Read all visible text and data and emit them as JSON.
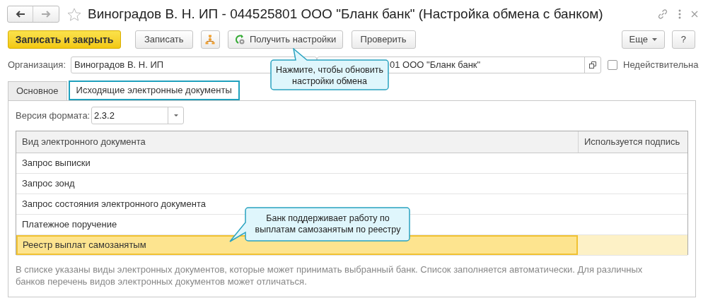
{
  "window": {
    "title": "Виноградов В. Н. ИП - 044525801 ООО \"Бланк банк\" (Настройка обмена с банком)"
  },
  "toolbar": [
    {
      "kind": "primary",
      "label": "Записать и закрыть"
    },
    {
      "kind": "default",
      "label": "Записать"
    },
    {
      "kind": "icon"
    },
    {
      "kind": "refresh",
      "label": "Получить настройки"
    },
    {
      "kind": "default",
      "label": "Проверить"
    },
    {
      "kind": "more",
      "label": "Еще"
    },
    {
      "kind": "default",
      "label": "?"
    }
  ],
  "organization": {
    "label": "Организация:",
    "value": "Виноградов В. Н. ИП"
  },
  "bank": {
    "value": "01 ООО \"Бланк банк\""
  },
  "invalid_checkbox": {
    "label": "Недействительна",
    "checked": false
  },
  "tabs": [
    {
      "label": "Основное",
      "selected": false
    },
    {
      "label": "Исходящие электронные документы",
      "selected": true
    }
  ],
  "format_version": {
    "label": "Версия формата:",
    "value": "2.3.2"
  },
  "table": {
    "columns": [
      "Вид электронного документа",
      "Используется подпись"
    ],
    "rows": [
      {
        "name": "Запрос выписки",
        "selected": false
      },
      {
        "name": "Запрос зонд",
        "selected": false
      },
      {
        "name": "Запрос состояния электронного документа",
        "selected": false
      },
      {
        "name": "Платежное поручение",
        "selected": false
      },
      {
        "name": "Реестр выплат самозанятым",
        "selected": true
      }
    ]
  },
  "note": "В списке указаны виды электронных документов, которые может принимать выбранный банк. Список заполняется автоматически. Для различных банков перечень видов электронных документов может отличаться.",
  "callouts": [
    {
      "text": "Нажмите, чтобы обновить настройки обмена"
    },
    {
      "text": "Банк поддерживает работу по выплатам самозанятым по реестру"
    }
  ]
}
